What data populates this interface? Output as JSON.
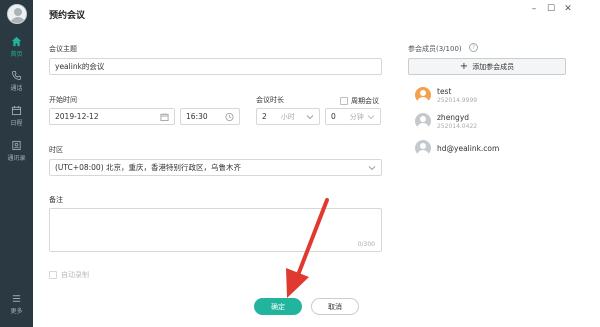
{
  "sidebar": {
    "items": [
      {
        "label": "首页",
        "icon": "home-icon",
        "active": true
      },
      {
        "label": "通话",
        "icon": "phone-icon",
        "active": false
      },
      {
        "label": "日程",
        "icon": "calendar-icon",
        "active": false
      },
      {
        "label": "通讯录",
        "icon": "contacts-icon",
        "active": false
      }
    ],
    "more_label": "更多"
  },
  "window": {
    "title": "预约会议",
    "controls": {
      "minimize": "–",
      "maximize": "☐",
      "close": "✕"
    }
  },
  "form": {
    "subject_label": "会议主题",
    "subject_value": "yealink的会议",
    "start_label": "开始时间",
    "start_date": "2019-12-12",
    "start_time": "16:30",
    "duration_label": "会议时长",
    "duration_hours": "2",
    "hours_unit": "小时",
    "duration_minutes": "0",
    "minutes_unit": "分钟",
    "recurring_label": "周期会议",
    "timezone_label": "时区",
    "timezone_value": "(UTC+08:00) 北京，重庆，香港特别行政区，乌鲁木齐",
    "notes_label": "备注",
    "notes_count": "0/300",
    "auto_record_label": "自动录制"
  },
  "actions": {
    "confirm_label": "确定",
    "cancel_label": "取消"
  },
  "attendees": {
    "header": "参会成员(3/100)",
    "help_icon": "?",
    "add_label": "添加参会成员",
    "members": [
      {
        "name": "test",
        "sub": "252014.9999",
        "color": "#f5a04a"
      },
      {
        "name": "zhengyd",
        "sub": "252014.0422",
        "color": "#c3c9cd"
      },
      {
        "name": "hd@yealink.com",
        "sub": "",
        "color": "#c3c9cd"
      }
    ]
  },
  "colors": {
    "accent": "#22b59e",
    "sidebar": "#2b3a42",
    "annotation": "#e03a30"
  }
}
